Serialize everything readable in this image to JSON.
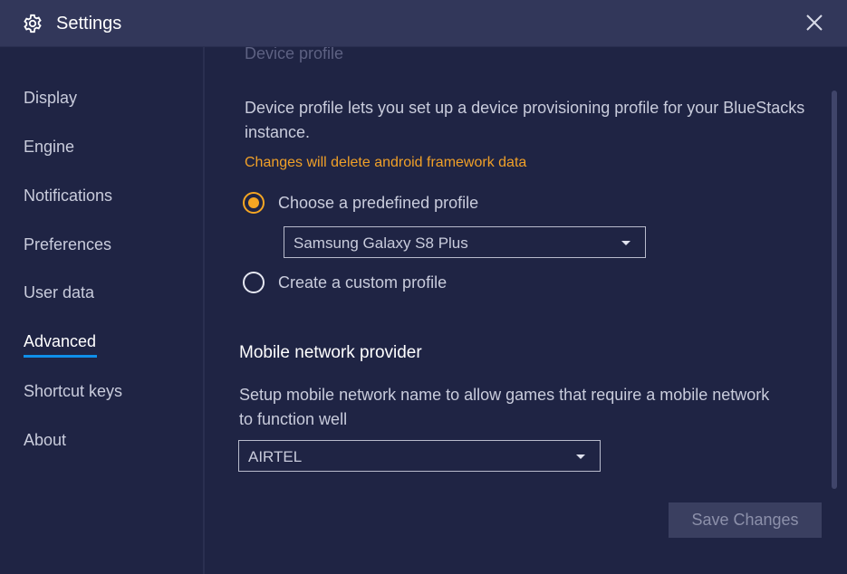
{
  "window": {
    "title": "Settings"
  },
  "sidebar": {
    "items": [
      {
        "label": "Display"
      },
      {
        "label": "Engine"
      },
      {
        "label": "Notifications"
      },
      {
        "label": "Preferences"
      },
      {
        "label": "User data"
      },
      {
        "label": "Advanced"
      },
      {
        "label": "Shortcut keys"
      },
      {
        "label": "About"
      }
    ],
    "active": "Advanced"
  },
  "device_profile": {
    "heading": "Device profile",
    "description": "Device profile lets you set up a device provisioning profile for your BlueStacks instance.",
    "warning": "Changes will delete android framework data",
    "option_predefined": "Choose a predefined profile",
    "selected_profile": "Samsung Galaxy S8 Plus",
    "option_custom": "Create a custom profile"
  },
  "mobile_network": {
    "heading": "Mobile network provider",
    "description": "Setup mobile network name to allow games that require a mobile network to function well",
    "selected_provider": "AIRTEL"
  },
  "actions": {
    "save_label": "Save Changes"
  },
  "colors": {
    "accent_orange": "#f5a623",
    "warning_text": "#f0a028",
    "active_underline": "#0f8fe8",
    "background": "#1f2444",
    "titlebar": "#32375a"
  }
}
